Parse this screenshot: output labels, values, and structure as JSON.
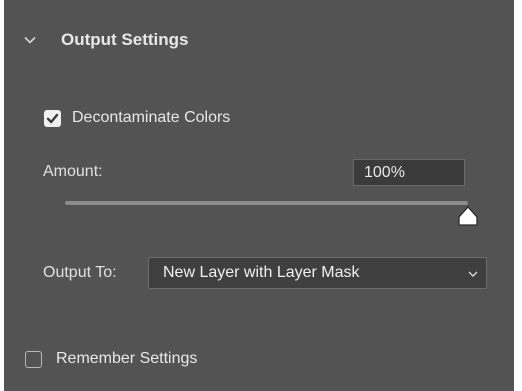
{
  "section": {
    "title": "Output Settings",
    "icon": "chevron-down-icon"
  },
  "decontaminate": {
    "label": "Decontaminate Colors",
    "checked": true,
    "icon": "checkmark-icon"
  },
  "amount": {
    "label": "Amount:",
    "value": "100%",
    "slider_fraction": 1.0
  },
  "output_to": {
    "label": "Output To:",
    "selected": "New Layer with Layer Mask",
    "icon": "chevron-down-icon"
  },
  "remember": {
    "label": "Remember Settings",
    "checked": false
  },
  "colors": {
    "panel_bg": "#535353",
    "field_bg": "#3b3b3b",
    "text": "#e6e6e6"
  }
}
